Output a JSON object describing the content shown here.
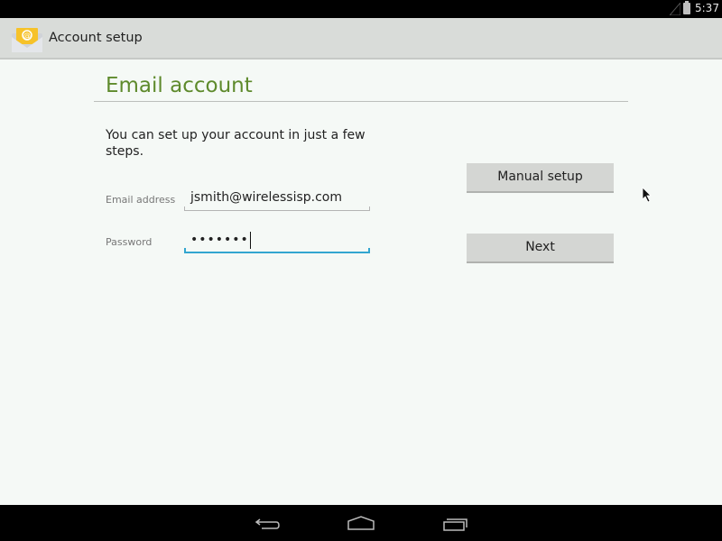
{
  "status_bar": {
    "time": "5:37",
    "icons": [
      "signal-icon",
      "battery-charging-icon"
    ]
  },
  "action_bar": {
    "app_icon": "email-app-icon",
    "title": "Account setup"
  },
  "main": {
    "title": "Email account",
    "intro": "You can set up your account in just a few steps.",
    "fields": [
      {
        "label": "Email address",
        "value": "jsmith@wirelessisp.com",
        "type": "email"
      },
      {
        "label": "Password",
        "value": "•••••••",
        "type": "password",
        "focused": true
      }
    ],
    "buttons": {
      "manual_setup": "Manual setup",
      "next": "Next"
    }
  },
  "nav_bar": {
    "buttons": [
      "back-icon",
      "home-icon",
      "recent-apps-icon"
    ]
  },
  "colors": {
    "title_green": "#5e8a2c",
    "focus_blue": "#33a6d0",
    "background": "#f5f9f6"
  }
}
